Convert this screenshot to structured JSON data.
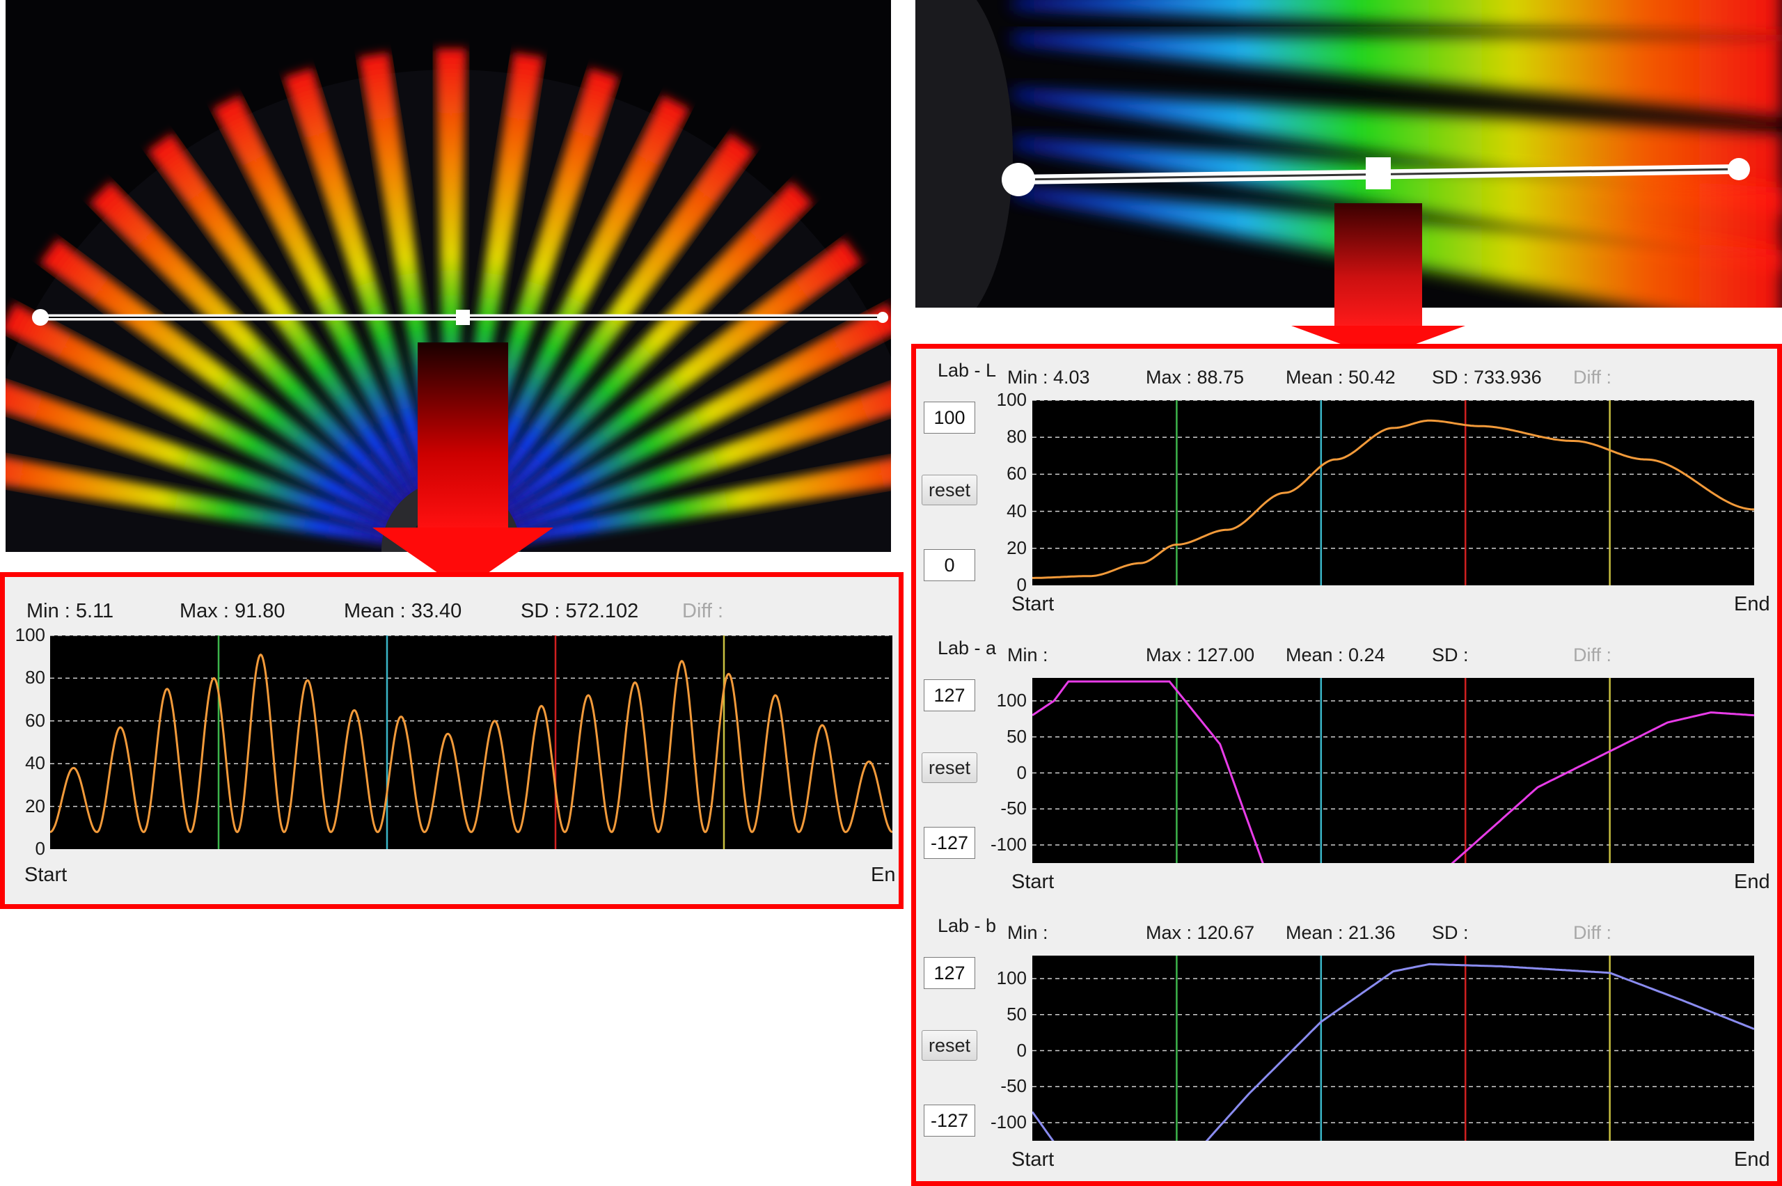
{
  "graph1": {
    "stats": {
      "min": "Min :   5.11",
      "max": "Max :  91.80",
      "mean": "Mean :  33.40",
      "sd": "SD : 572.102",
      "diff": "Diff :"
    },
    "x_start": "Start",
    "x_end": "En",
    "colors": {
      "line": "#f29a3a"
    }
  },
  "graph_lab_l": {
    "label": "Lab - L",
    "stats": {
      "min": "Min :   4.03",
      "max": "Max :  88.75",
      "mean": "Mean :  50.42",
      "sd": "SD : 733.936",
      "diff": "Diff :"
    },
    "upper_box": "100",
    "lower_box": "0",
    "reset": "reset",
    "x_start": "Start",
    "x_end": "End",
    "colors": {
      "line": "#f29a3a"
    }
  },
  "graph_lab_a": {
    "label": "Lab - a",
    "stats": {
      "min": "Min :",
      "max": "Max : 127.00",
      "mean": "Mean :   0.24",
      "sd": "SD :",
      "diff": "Diff :"
    },
    "upper_box": "127",
    "lower_box": "-127",
    "reset": "reset",
    "x_start": "Start",
    "x_end": "End",
    "colors": {
      "line": "#e83ce8"
    }
  },
  "graph_lab_b": {
    "label": "Lab - b",
    "stats": {
      "min": "Min :",
      "max": "Max : 120.67",
      "mean": "Mean :  21.36",
      "sd": "SD :",
      "diff": "Diff :"
    },
    "upper_box": "127",
    "lower_box": "-127",
    "reset": "reset",
    "x_start": "Start",
    "x_end": "End",
    "colors": {
      "line": "#8a8cf0"
    }
  },
  "ticks": {
    "graph1_y": [
      "100",
      "80",
      "60",
      "40",
      "20",
      "0"
    ],
    "lab_l_y": [
      "100",
      "80",
      "60",
      "40",
      "20",
      "0"
    ],
    "lab_a_y": [
      "100",
      "50",
      "0",
      "-50",
      "-100"
    ],
    "lab_b_y": [
      "100",
      "50",
      "0",
      "-50",
      "-100"
    ]
  },
  "marker_colors": {
    "green": "#3cb44b",
    "cyan": "#3ab6c8",
    "red": "#d02020",
    "yellow": "#c8c040"
  },
  "accent": "#ff0000"
}
